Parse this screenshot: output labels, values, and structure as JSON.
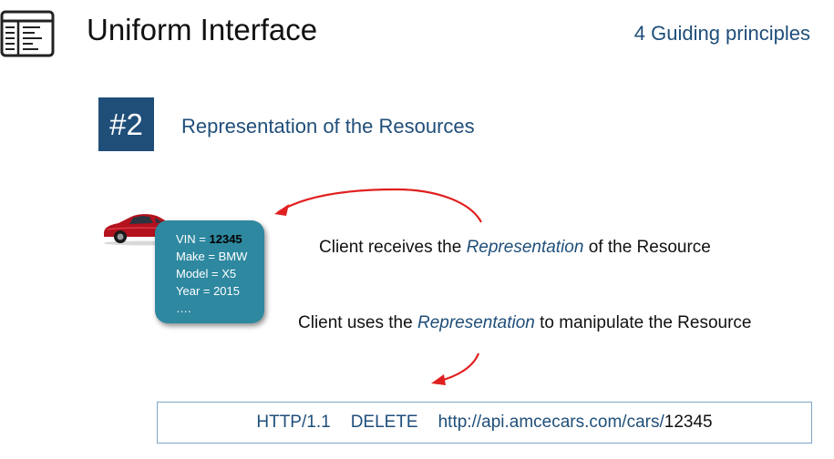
{
  "header": {
    "title": "Uniform Interface",
    "subtitle": "4 Guiding principles"
  },
  "section": {
    "number": "#2",
    "heading": "Representation of the Resources"
  },
  "representation": {
    "vin_label": "VIN = ",
    "vin_value": "12345",
    "make": "Make = BMW",
    "model": "Model = X5",
    "year": "Year = 2015",
    "ellipsis": "…."
  },
  "statements": {
    "receives": {
      "before": "Client receives the ",
      "emphasis": "Representation",
      "after": " of the Resource"
    },
    "uses": {
      "before": "Client uses the ",
      "emphasis": "Representation",
      "after": " to manipulate the Resource"
    }
  },
  "http_request": {
    "version": "HTTP/1.1",
    "method": "DELETE",
    "url_base": "http://api.amcecars.com/cars/",
    "resource_id": "12345"
  },
  "colors": {
    "accent": "#1f4e79",
    "card": "#2e88a0",
    "arrow": "#e02020"
  }
}
